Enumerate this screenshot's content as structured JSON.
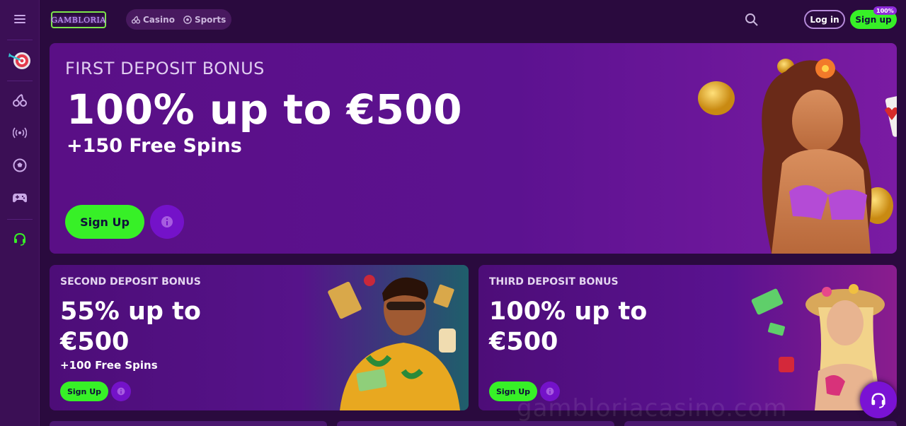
{
  "header": {
    "logo_text": "GAMBLORIA",
    "nav": [
      {
        "label": "Casino",
        "icon": "cherry-icon"
      },
      {
        "label": "Sports",
        "icon": "soccer-ball-icon"
      }
    ],
    "login_label": "Log in",
    "signup_label": "Sign up",
    "signup_badge": "100%"
  },
  "sidebar": {
    "items": [
      {
        "icon": "menu-icon"
      },
      {
        "icon": "dart-target-icon"
      },
      {
        "icon": "cherry-icon"
      },
      {
        "icon": "live-broadcast-icon"
      },
      {
        "icon": "soccer-ball-icon"
      },
      {
        "icon": "gamepad-icon"
      },
      {
        "icon": "headset-support-icon"
      }
    ]
  },
  "hero": {
    "label": "FIRST DEPOSIT BONUS",
    "title": "100% up to €500",
    "subtitle": "+150 Free Spins",
    "button_label": "Sign Up"
  },
  "cards": [
    {
      "label": "SECOND DEPOSIT BONUS",
      "title_line1": "55% up to",
      "title_line2": "€500",
      "subtitle": "+100 Free Spins",
      "button_label": "Sign Up"
    },
    {
      "label": "THIRD DEPOSIT BONUS",
      "title_line1": "100% up to",
      "title_line2": "€500",
      "subtitle": "",
      "button_label": "Sign Up"
    }
  ],
  "watermark": "gambloriacasino.com",
  "colors": {
    "accent_green": "#37f027",
    "background": "#2a0a3e",
    "purple": "#5c1290",
    "info_purple": "#7412c9"
  }
}
